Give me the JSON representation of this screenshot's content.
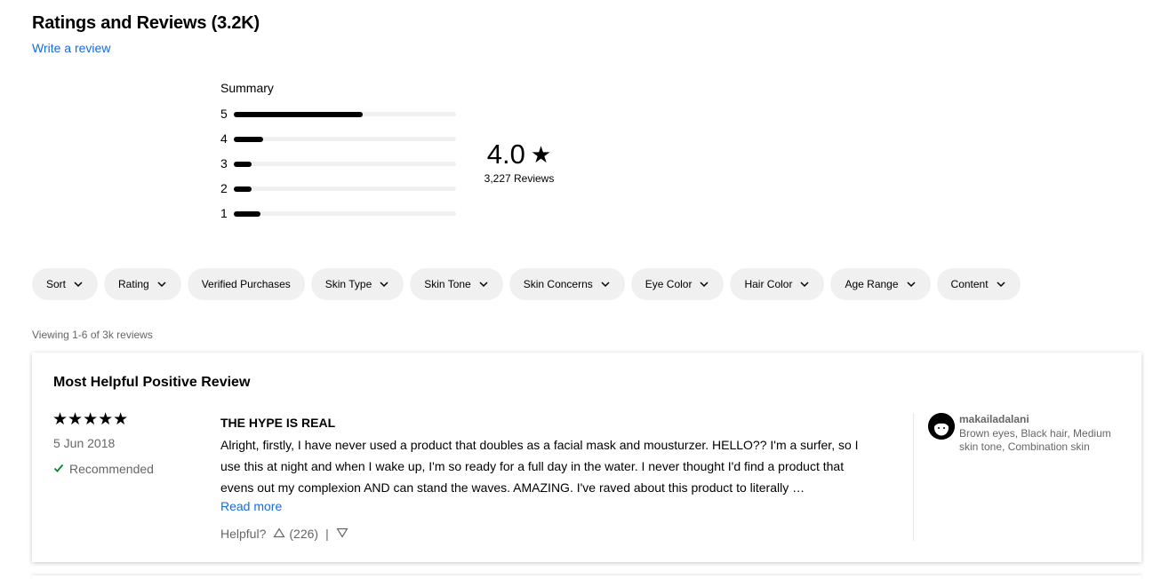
{
  "header": {
    "title": "Ratings and Reviews (3.2K)",
    "write_review": "Write a review"
  },
  "summary": {
    "label": "Summary",
    "distribution": [
      {
        "stars": "5",
        "share": 0.58
      },
      {
        "stars": "4",
        "share": 0.13
      },
      {
        "stars": "3",
        "share": 0.08
      },
      {
        "stars": "2",
        "share": 0.08
      },
      {
        "stars": "1",
        "share": 0.12
      }
    ],
    "average": "4.0",
    "star_glyph": "★",
    "review_count": "3,227 Reviews"
  },
  "filters": [
    {
      "label": "Sort",
      "dropdown": true
    },
    {
      "label": "Rating",
      "dropdown": true
    },
    {
      "label": "Verified Purchases",
      "dropdown": false
    },
    {
      "label": "Skin Type",
      "dropdown": true
    },
    {
      "label": "Skin Tone",
      "dropdown": true
    },
    {
      "label": "Skin Concerns",
      "dropdown": true
    },
    {
      "label": "Eye Color",
      "dropdown": true
    },
    {
      "label": "Hair Color",
      "dropdown": true
    },
    {
      "label": "Age Range",
      "dropdown": true
    },
    {
      "label": "Content",
      "dropdown": true
    }
  ],
  "viewing": "Viewing 1-6 of 3k reviews",
  "review": {
    "heading": "Most Helpful Positive Review",
    "stars": "★★★★★",
    "rating": 5,
    "date": "5 Jun 2018",
    "recommended": "Recommended",
    "title": "THE HYPE IS REAL",
    "body": "Alright, firstly, I have never used a product that doubles as a facial mask and mousturzer. HELLO?? I'm a surfer, so I use this at night and when I wake up, I'm so ready for a full day in the water. I never thought I'd find a product that evens out my complexion AND can stand the waves. AMAZING. I've raved about this product to literally …",
    "read_more": "Read more",
    "helpful_label": "Helpful?",
    "upvotes": "(226)",
    "separator": "|",
    "username": "makailadalani",
    "traits": "Brown eyes, Black hair, Medium skin tone, Combination skin"
  },
  "colors": {
    "link": "#136bea",
    "pill_bg": "#f0f0f0",
    "recommended_check": "#008a2e",
    "muted_text": "#666666"
  }
}
